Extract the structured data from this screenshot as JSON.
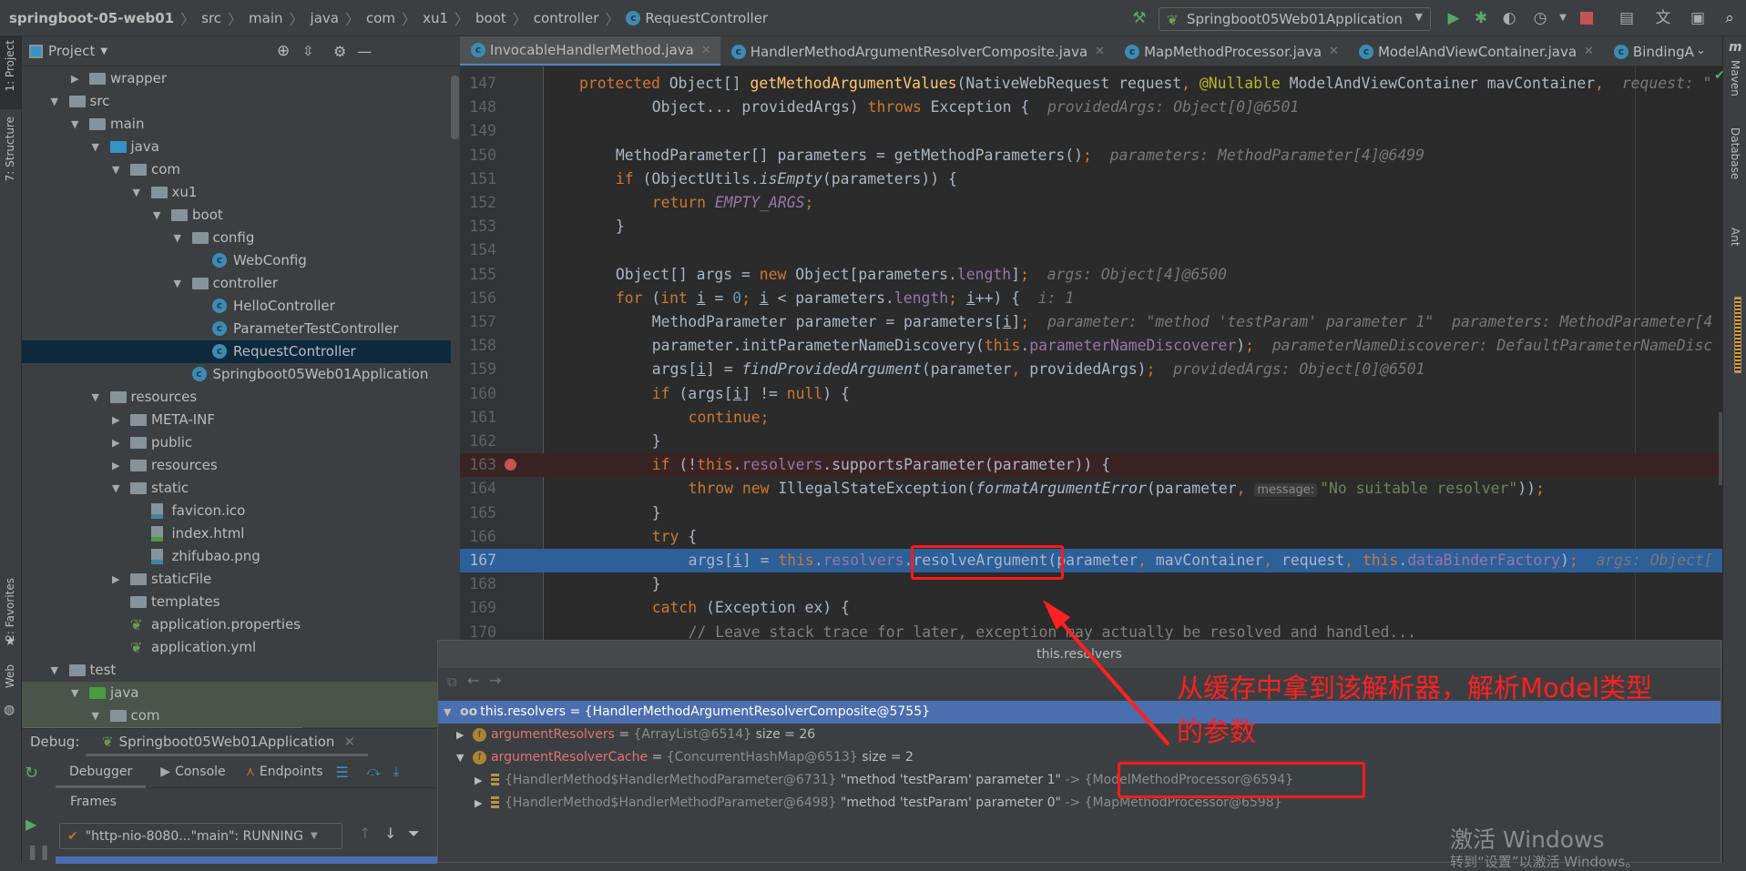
{
  "breadcrumb": [
    "springboot-05-web01",
    "src",
    "main",
    "java",
    "com",
    "xu1",
    "boot",
    "controller",
    "RequestController"
  ],
  "toolbar": {
    "run_config": "Springboot05Web01Application",
    "icons": [
      "hammer-icon",
      "run-icon",
      "debug-icon",
      "coverage-icon",
      "profile-icon",
      "stop-icon",
      "project-structure-icon",
      "translate-icon",
      "presentation-icon",
      "search-icon"
    ]
  },
  "left_strip": {
    "project": "1: Project",
    "structure": "7: Structure",
    "favorites": "2: Favorites",
    "web": "Web"
  },
  "right_strip": {
    "maven": "Maven",
    "database": "Database",
    "ant": "Ant"
  },
  "project_panel": {
    "title": "Project"
  },
  "tree": [
    {
      "label": "wrapper",
      "depth": 2,
      "toggle": "collapsed",
      "icon": "folder"
    },
    {
      "label": "src",
      "depth": 1,
      "toggle": "expanded",
      "icon": "folder"
    },
    {
      "label": "main",
      "depth": 2,
      "toggle": "expanded",
      "icon": "folder"
    },
    {
      "label": "java",
      "depth": 3,
      "toggle": "expanded",
      "icon": "source-folder"
    },
    {
      "label": "com",
      "depth": 4,
      "toggle": "expanded",
      "icon": "package"
    },
    {
      "label": "xu1",
      "depth": 5,
      "toggle": "expanded",
      "icon": "package"
    },
    {
      "label": "boot",
      "depth": 6,
      "toggle": "expanded",
      "icon": "package"
    },
    {
      "label": "config",
      "depth": 7,
      "toggle": "expanded",
      "icon": "package"
    },
    {
      "label": "WebConfig",
      "depth": 8,
      "icon": "class"
    },
    {
      "label": "controller",
      "depth": 7,
      "toggle": "expanded",
      "icon": "package"
    },
    {
      "label": "HelloController",
      "depth": 8,
      "icon": "class"
    },
    {
      "label": "ParameterTestController",
      "depth": 8,
      "icon": "class"
    },
    {
      "label": "RequestController",
      "depth": 8,
      "icon": "class",
      "selected": true
    },
    {
      "label": "Springboot05Web01Application",
      "depth": 7,
      "icon": "spring-class"
    },
    {
      "label": "resources",
      "depth": 3,
      "toggle": "expanded",
      "icon": "resources-folder"
    },
    {
      "label": "META-INF",
      "depth": 4,
      "toggle": "collapsed",
      "icon": "folder"
    },
    {
      "label": "public",
      "depth": 4,
      "toggle": "collapsed",
      "icon": "folder"
    },
    {
      "label": "resources",
      "depth": 4,
      "toggle": "collapsed",
      "icon": "folder"
    },
    {
      "label": "static",
      "depth": 4,
      "toggle": "expanded",
      "icon": "folder"
    },
    {
      "label": "favicon.ico",
      "depth": 5,
      "icon": "image-file"
    },
    {
      "label": "index.html",
      "depth": 5,
      "icon": "html-file"
    },
    {
      "label": "zhifubao.png",
      "depth": 5,
      "icon": "image-file"
    },
    {
      "label": "staticFile",
      "depth": 4,
      "toggle": "collapsed",
      "icon": "folder"
    },
    {
      "label": "templates",
      "depth": 4,
      "icon": "folder"
    },
    {
      "label": "application.properties",
      "depth": 4,
      "icon": "spring-file"
    },
    {
      "label": "application.yml",
      "depth": 4,
      "icon": "spring-file"
    },
    {
      "label": "test",
      "depth": 1,
      "toggle": "expanded",
      "icon": "folder"
    },
    {
      "label": "java",
      "depth": 2,
      "toggle": "expanded",
      "icon": "test-folder",
      "green": true
    },
    {
      "label": "com",
      "depth": 3,
      "toggle": "expanded",
      "icon": "package",
      "green": true
    }
  ],
  "tabs": [
    {
      "label": "InvocableHandlerMethod.java",
      "active": true
    },
    {
      "label": "HandlerMethodArgumentResolverComposite.java"
    },
    {
      "label": "MapMethodProcessor.java"
    },
    {
      "label": "ModelAndViewContainer.java"
    },
    {
      "label": "BindingA"
    }
  ],
  "code": [
    {
      "n": "147",
      "ind": 0,
      "t": [
        [
          "protected ",
          "kw"
        ],
        [
          "Object[] ",
          "pl"
        ],
        [
          "getMethodArgumentValues",
          "fn"
        ],
        [
          "(NativeWebRequest request",
          "pl"
        ],
        [
          ", ",
          "kw"
        ],
        [
          "@Nullable ",
          "ann"
        ],
        [
          "ModelAndViewContainer mavContainer",
          "pl"
        ],
        [
          ",",
          "kw"
        ],
        [
          "  request: \"",
          "hint"
        ]
      ]
    },
    {
      "n": "148",
      "ind": 8,
      "t": [
        [
          "Object... providedArgs) ",
          "pl"
        ],
        [
          "throws ",
          "kw"
        ],
        [
          "Exception { ",
          "pl"
        ],
        [
          " providedArgs: Object[0]@6501",
          "hint"
        ]
      ]
    },
    {
      "n": "149",
      "ind": 0,
      "t": []
    },
    {
      "n": "150",
      "ind": 4,
      "t": [
        [
          "MethodParameter[] parameters = getMethodParameters()",
          "pl"
        ],
        [
          ";",
          "kw"
        ],
        [
          "  parameters: MethodParameter[4]@6499",
          "hint"
        ]
      ]
    },
    {
      "n": "151",
      "ind": 4,
      "t": [
        [
          "if ",
          "kw"
        ],
        [
          "(ObjectUtils.",
          "pl"
        ],
        [
          "isEmpty",
          "it"
        ],
        [
          "(parameters)) {",
          "pl"
        ]
      ]
    },
    {
      "n": "152",
      "ind": 8,
      "t": [
        [
          "return ",
          "kw"
        ],
        [
          "EMPTY_ARGS",
          "const"
        ],
        [
          ";",
          "kw"
        ]
      ]
    },
    {
      "n": "153",
      "ind": 4,
      "t": [
        [
          "}",
          "pl"
        ]
      ]
    },
    {
      "n": "154",
      "ind": 0,
      "t": []
    },
    {
      "n": "155",
      "ind": 4,
      "t": [
        [
          "Object[] args = ",
          "pl"
        ],
        [
          "new ",
          "kw"
        ],
        [
          "Object[parameters.",
          "pl"
        ],
        [
          "length",
          "field"
        ],
        [
          "]",
          "pl"
        ],
        [
          ";",
          "kw"
        ],
        [
          "  args: Object[4]@6500",
          "hint"
        ]
      ]
    },
    {
      "n": "156",
      "ind": 4,
      "t": [
        [
          "for ",
          "kw"
        ],
        [
          "(",
          "pl"
        ],
        [
          "int ",
          "kw"
        ],
        [
          "i",
          "u"
        ],
        [
          " = ",
          "pl"
        ],
        [
          "0",
          "num"
        ],
        [
          "; ",
          "kw"
        ],
        [
          "i",
          "u"
        ],
        [
          " < parameters.",
          "pl"
        ],
        [
          "length",
          "field"
        ],
        [
          "; ",
          "kw"
        ],
        [
          "i",
          "u"
        ],
        [
          "++) { ",
          "pl"
        ],
        [
          " i: 1",
          "hint"
        ]
      ]
    },
    {
      "n": "157",
      "ind": 8,
      "t": [
        [
          "MethodParameter parameter = parameters[",
          "pl"
        ],
        [
          "i",
          "u"
        ],
        [
          "]",
          "pl"
        ],
        [
          ";",
          "kw"
        ],
        [
          "  parameter: \"method 'testParam' parameter 1\"  parameters: MethodParameter[4",
          "hint"
        ]
      ]
    },
    {
      "n": "158",
      "ind": 8,
      "t": [
        [
          "parameter.initParameterNameDiscovery(",
          "pl"
        ],
        [
          "this",
          "kw"
        ],
        [
          ".",
          "pl"
        ],
        [
          "parameterNameDiscoverer",
          "field"
        ],
        [
          ")",
          "pl"
        ],
        [
          ";",
          "kw"
        ],
        [
          "  parameterNameDiscoverer: DefaultParameterNameDisc",
          "hint"
        ]
      ]
    },
    {
      "n": "159",
      "ind": 8,
      "t": [
        [
          "args[",
          "pl"
        ],
        [
          "i",
          "u"
        ],
        [
          "] = ",
          "pl"
        ],
        [
          "findProvidedArgument",
          "it"
        ],
        [
          "(parameter",
          "pl"
        ],
        [
          ", ",
          "kw"
        ],
        [
          "providedArgs)",
          "pl"
        ],
        [
          ";",
          "kw"
        ],
        [
          "  providedArgs: Object[0]@6501",
          "hint"
        ]
      ]
    },
    {
      "n": "160",
      "ind": 8,
      "t": [
        [
          "if ",
          "kw"
        ],
        [
          "(args[",
          "pl"
        ],
        [
          "i",
          "u"
        ],
        [
          "] != ",
          "pl"
        ],
        [
          "null",
          "kw"
        ],
        [
          ") {",
          "pl"
        ]
      ]
    },
    {
      "n": "161",
      "ind": 12,
      "t": [
        [
          "continue;",
          "kw"
        ]
      ]
    },
    {
      "n": "162",
      "ind": 8,
      "t": [
        [
          "}",
          "pl"
        ]
      ]
    },
    {
      "n": "163",
      "ind": 8,
      "bp": true,
      "t": [
        [
          "if ",
          "kw"
        ],
        [
          "(!",
          "pl"
        ],
        [
          "this",
          "kw"
        ],
        [
          ".",
          "pl"
        ],
        [
          "resolvers",
          "field"
        ],
        [
          ".supportsParameter(parameter)) {",
          "pl"
        ]
      ]
    },
    {
      "n": "164",
      "ind": 12,
      "t": [
        [
          "throw new ",
          "kw"
        ],
        [
          "IllegalStateException(",
          "pl"
        ],
        [
          "formatArgumentError",
          "it"
        ],
        [
          "(parameter",
          "pl"
        ],
        [
          ", ",
          "kw"
        ],
        [
          "message:",
          "inlay"
        ],
        [
          "\"No suitable resolver\"",
          "str"
        ],
        [
          "))",
          "pl"
        ],
        [
          ";",
          "kw"
        ]
      ]
    },
    {
      "n": "165",
      "ind": 8,
      "t": [
        [
          "}",
          "pl"
        ]
      ]
    },
    {
      "n": "166",
      "ind": 8,
      "t": [
        [
          "try ",
          "kw"
        ],
        [
          "{",
          "pl"
        ]
      ]
    },
    {
      "n": "167",
      "ind": 12,
      "cur": true,
      "t": [
        [
          "args[",
          "pl"
        ],
        [
          "i",
          "u"
        ],
        [
          "] = ",
          "pl"
        ],
        [
          "this",
          "kw"
        ],
        [
          ".",
          "pl"
        ],
        [
          "resolvers",
          "field"
        ],
        [
          ".",
          "pl"
        ],
        [
          "resolveArgument(parameter",
          "pl"
        ],
        [
          ", ",
          "kw"
        ],
        [
          "mavContainer",
          "pl"
        ],
        [
          ", ",
          "kw"
        ],
        [
          "request",
          "pl"
        ],
        [
          ", ",
          "kw"
        ],
        [
          "this",
          "kw"
        ],
        [
          ".",
          "pl"
        ],
        [
          "dataBinderFactory",
          "field"
        ],
        [
          ")",
          "pl"
        ],
        [
          ";",
          "kw"
        ],
        [
          "  args: Object[",
          "hint"
        ]
      ]
    },
    {
      "n": "168",
      "ind": 8,
      "t": [
        [
          "}",
          "pl"
        ]
      ]
    },
    {
      "n": "169",
      "ind": 8,
      "t": [
        [
          "catch ",
          "kw"
        ],
        [
          "(Exception ex) {",
          "pl"
        ]
      ]
    },
    {
      "n": "170",
      "ind": 12,
      "t": [
        [
          "// Leave stack trace for later, exception may actually be resolved and handled...",
          "cmt"
        ]
      ]
    }
  ],
  "popup": {
    "title": "this.resolvers",
    "rows": [
      {
        "toggle": "expanded",
        "icon": "watch",
        "name": "this.resolvers",
        "eq": " = ",
        "value": "{HandlerMethodArgumentResolverComposite@5755}",
        "extra": "",
        "selected": true
      },
      {
        "toggle": "collapsed",
        "icon": "field",
        "name": "argumentResolvers",
        "eq": " = ",
        "value": "{ArrayList@6514}",
        "extra": " size = 26"
      },
      {
        "toggle": "expanded",
        "icon": "field",
        "name": "argumentResolverCache",
        "eq": " = ",
        "value": "{ConcurrentHashMap@6513}",
        "extra": " size = 2"
      },
      {
        "toggle": "collapsed",
        "icon": "entry",
        "name": "{HandlerMethod$HandlerMethodParameter@6731}",
        "eq": "",
        "value": " \"method 'testParam' parameter 1\"",
        "extra": " -> {ModelMethodProcessor@6594}",
        "depth": 2
      },
      {
        "toggle": "collapsed",
        "icon": "entry",
        "name": "{HandlerMethod$HandlerMethodParameter@6498}",
        "eq": "",
        "value": " \"method 'testParam' parameter 0\"",
        "extra": " -> {MapMethodProcessor@6598}",
        "depth": 2
      }
    ]
  },
  "debug": {
    "label": "Debug:",
    "session": "Springboot05Web01Application",
    "tabs": [
      "Debugger",
      "Console",
      "Endpoints"
    ],
    "frames": "Frames",
    "thread": "\"http-nio-8080...\"main\": RUNNING"
  },
  "annotation": {
    "line1": "从缓存中拿到该解析器，解析Model类型",
    "line2": "的参数",
    "color": "#ff2020"
  },
  "watermark": {
    "line1": "激活 Windows",
    "line2": "转到“设置”以激活 Windows。"
  },
  "colors": {
    "accent": "#4a88c7",
    "selection": "#4b6eaf",
    "current_line": "#2d5f99",
    "breakpoint": "#c75450"
  }
}
